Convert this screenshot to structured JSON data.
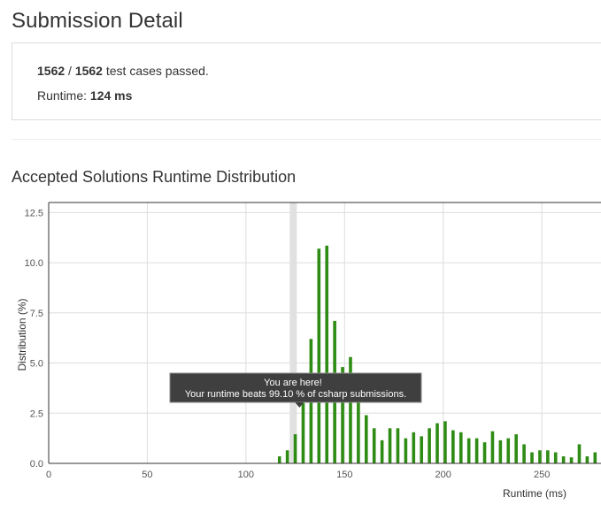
{
  "page": {
    "title": "Submission Detail"
  },
  "summary": {
    "passed": "1562",
    "separator": " / ",
    "total": "1562",
    "passed_suffix": " test cases passed.",
    "runtime_label": "Runtime: ",
    "runtime_value": "124 ms"
  },
  "section": {
    "title": "Accepted Solutions Runtime Distribution"
  },
  "chart_data": {
    "type": "bar",
    "xlabel": "Runtime (ms)",
    "ylabel": "Distribution (%)",
    "xlim": [
      0,
      280
    ],
    "ylim": [
      0,
      13
    ],
    "x_ticks": [
      "0",
      "50",
      "100",
      "150",
      "200",
      "250"
    ],
    "y_ticks": [
      "0.0",
      "2.5",
      "5.0",
      "7.5",
      "10.0",
      "12.5"
    ],
    "grid": true,
    "highlight_x": 124,
    "tooltip": {
      "line1": "You are here!",
      "line2": "Your runtime beats 99.10 % of csharp submissions."
    },
    "bar_color": "#2e8b14",
    "x": [
      117,
      121,
      125,
      129,
      133,
      137,
      141,
      145,
      149,
      153,
      157,
      161,
      165,
      169,
      173,
      177,
      181,
      185,
      189,
      193,
      197,
      201,
      205,
      209,
      213,
      217,
      221,
      225,
      229,
      233,
      237,
      241,
      245,
      249,
      253,
      257,
      261,
      265,
      269,
      273,
      277
    ],
    "values": [
      0.35,
      0.65,
      1.45,
      3.0,
      6.2,
      10.7,
      10.85,
      7.1,
      4.8,
      5.3,
      3.9,
      2.4,
      1.75,
      1.15,
      1.75,
      1.75,
      1.25,
      1.55,
      1.35,
      1.75,
      2.0,
      2.1,
      1.65,
      1.55,
      1.25,
      1.25,
      1.05,
      1.6,
      1.15,
      1.25,
      1.45,
      0.95,
      0.55,
      0.65,
      0.65,
      0.55,
      0.35,
      0.3,
      0.95,
      0.35,
      0.55
    ]
  }
}
